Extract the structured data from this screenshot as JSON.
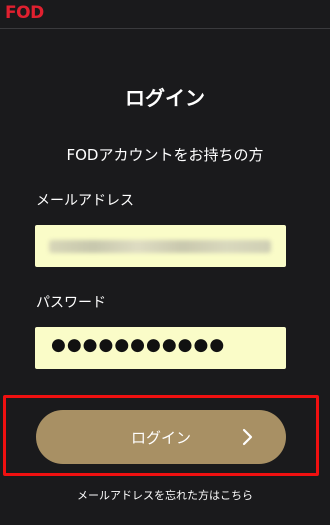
{
  "header": {
    "logo_text": "FOD",
    "logo_color": "#e0202f"
  },
  "main": {
    "title": "ログイン",
    "subtitle": "FODアカウントをお持ちの方",
    "email": {
      "label": "メールアドレス",
      "value_obscured": true
    },
    "password": {
      "label": "パスワード",
      "value_masked": "●●●●●●●●●●●"
    },
    "login_button": {
      "label": "ログイン",
      "icon": "chevron-right-icon",
      "color": "#a89064"
    },
    "forgot_link": "メールアドレスを忘れた方はこちら"
  },
  "colors": {
    "background": "#1a1a1c",
    "field_background": "#fafcc8",
    "highlight_border": "#f01010"
  }
}
